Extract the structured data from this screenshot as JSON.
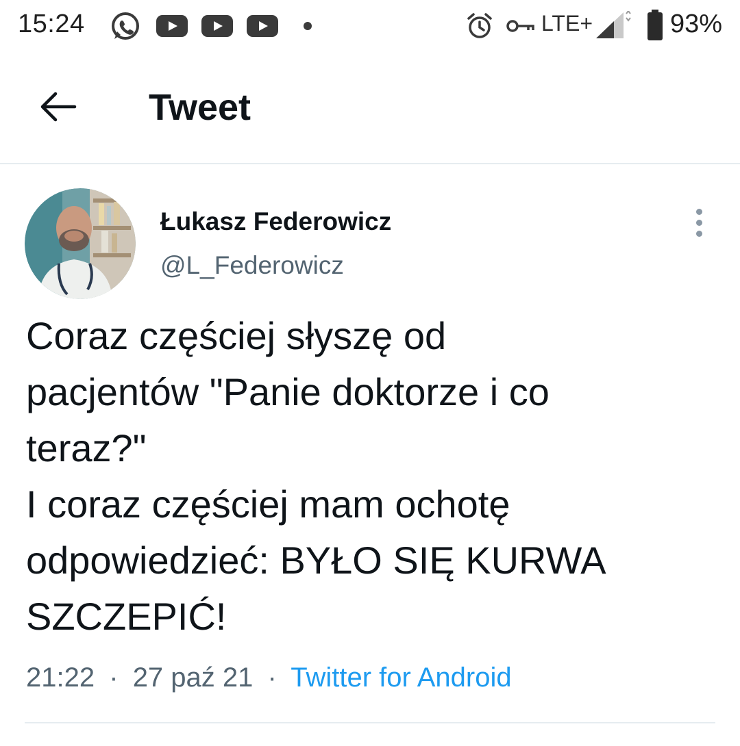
{
  "status_bar": {
    "time": "15:24",
    "network": "LTE+",
    "battery": "93%",
    "icons": [
      "whatsapp-icon",
      "youtube-icon",
      "youtube-icon",
      "youtube-icon",
      "notification-dot",
      "alarm-icon",
      "vpn-key-icon",
      "signal-icon",
      "battery-icon"
    ]
  },
  "header": {
    "title": "Tweet",
    "back_icon": "arrow-left-icon"
  },
  "tweet": {
    "author_name": "Łukasz Federowicz",
    "author_handle": "@L_Federowicz",
    "text_lines": [
      "Coraz częściej słyszę od",
      "pacjentów \"Panie doktorze i co",
      "teraz?\"",
      "I coraz częściej mam ochotę",
      "odpowiedzieć: BYŁO SIĘ KURWA",
      "SZCZEPIĆ!"
    ],
    "time": "21:22",
    "date": "27 paź 21",
    "separator": "·",
    "source": "Twitter for Android",
    "more_icon": "more-vertical-icon"
  },
  "colors": {
    "text_primary": "#0f1419",
    "text_secondary": "#536471",
    "link": "#1d9bf0",
    "divider": "#e6ecf0"
  }
}
